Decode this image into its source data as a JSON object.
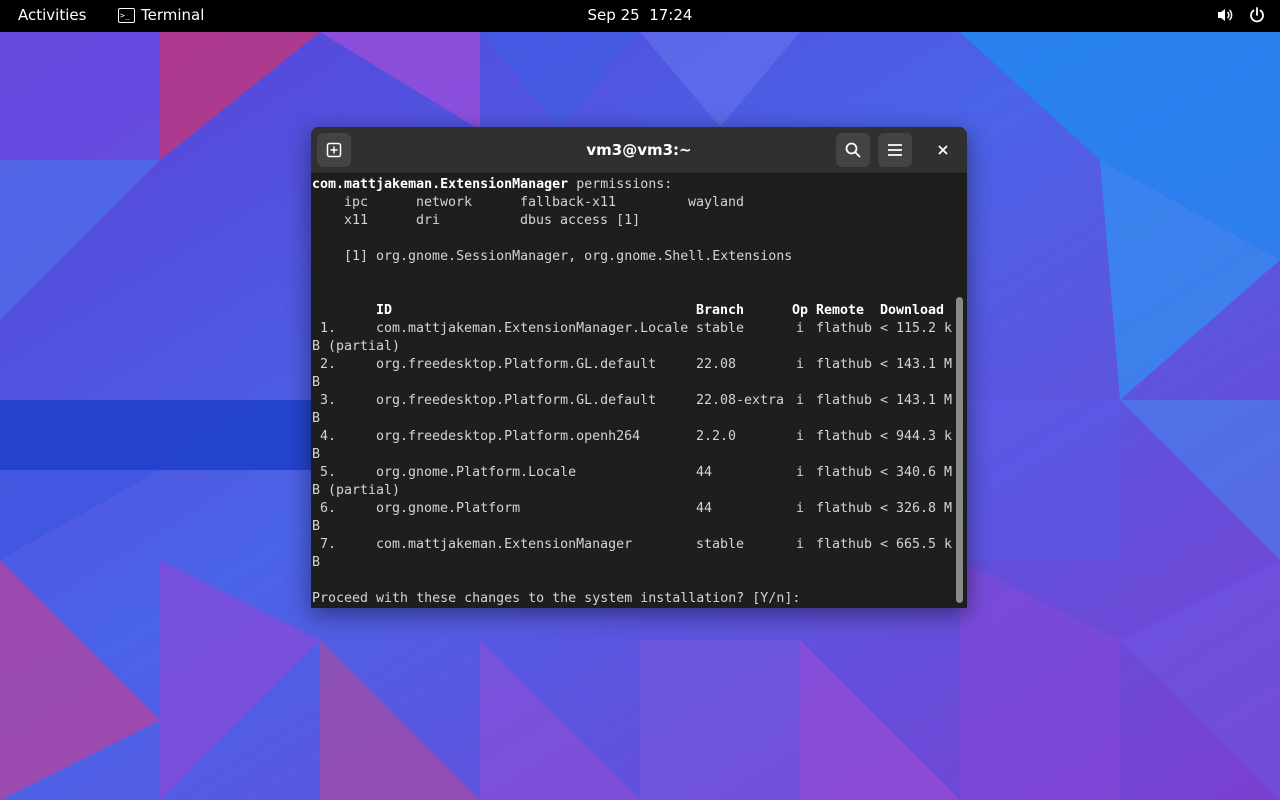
{
  "topbar": {
    "activities": "Activities",
    "app_name": "Terminal",
    "app_icon_glyph": ">_",
    "date": "Sep 25",
    "time": "17:24",
    "volume_icon": "volume-icon",
    "power_icon": "power-icon"
  },
  "window": {
    "title": "vm3@vm3:~"
  },
  "terminal": {
    "app_id": "com.mattjakeman.ExtensionManager",
    "permissions_suffix": " permissions:",
    "permissions_row1": [
      "ipc",
      "network",
      "fallback-x11",
      "wayland"
    ],
    "permissions_row2": [
      "x11",
      "dri",
      "dbus access [1]"
    ],
    "footnote": "[1] org.gnome.SessionManager, org.gnome.Shell.Extensions",
    "headers": {
      "id": "ID",
      "branch": "Branch",
      "op": "Op",
      "remote": "Remote",
      "download": "Download"
    },
    "rows": [
      {
        "num": "1.",
        "id": "com.mattjakeman.ExtensionManager.Locale",
        "branch": "stable",
        "op": "i",
        "remote": "flathub",
        "download": "< 115.2 k",
        "wrap": "B (partial)"
      },
      {
        "num": "2.",
        "id": "org.freedesktop.Platform.GL.default",
        "branch": "22.08",
        "op": "i",
        "remote": "flathub",
        "download": "< 143.1 M",
        "wrap": "B"
      },
      {
        "num": "3.",
        "id": "org.freedesktop.Platform.GL.default",
        "branch": "22.08-extra",
        "op": "i",
        "remote": "flathub",
        "download": "< 143.1 M",
        "wrap": "B"
      },
      {
        "num": "4.",
        "id": "org.freedesktop.Platform.openh264",
        "branch": "2.2.0",
        "op": "i",
        "remote": "flathub",
        "download": "< 944.3 k",
        "wrap": "B"
      },
      {
        "num": "5.",
        "id": "org.gnome.Platform.Locale",
        "branch": "44",
        "op": "i",
        "remote": "flathub",
        "download": "< 340.6 M",
        "wrap": "B (partial)"
      },
      {
        "num": "6.",
        "id": "org.gnome.Platform",
        "branch": "44",
        "op": "i",
        "remote": "flathub",
        "download": "< 326.8 M",
        "wrap": "B"
      },
      {
        "num": "7.",
        "id": "com.mattjakeman.ExtensionManager",
        "branch": "stable",
        "op": "i",
        "remote": "flathub",
        "download": "< 665.5 k",
        "wrap": "B"
      }
    ],
    "prompt": "Proceed with these changes to the system installation? [Y/n]:"
  }
}
